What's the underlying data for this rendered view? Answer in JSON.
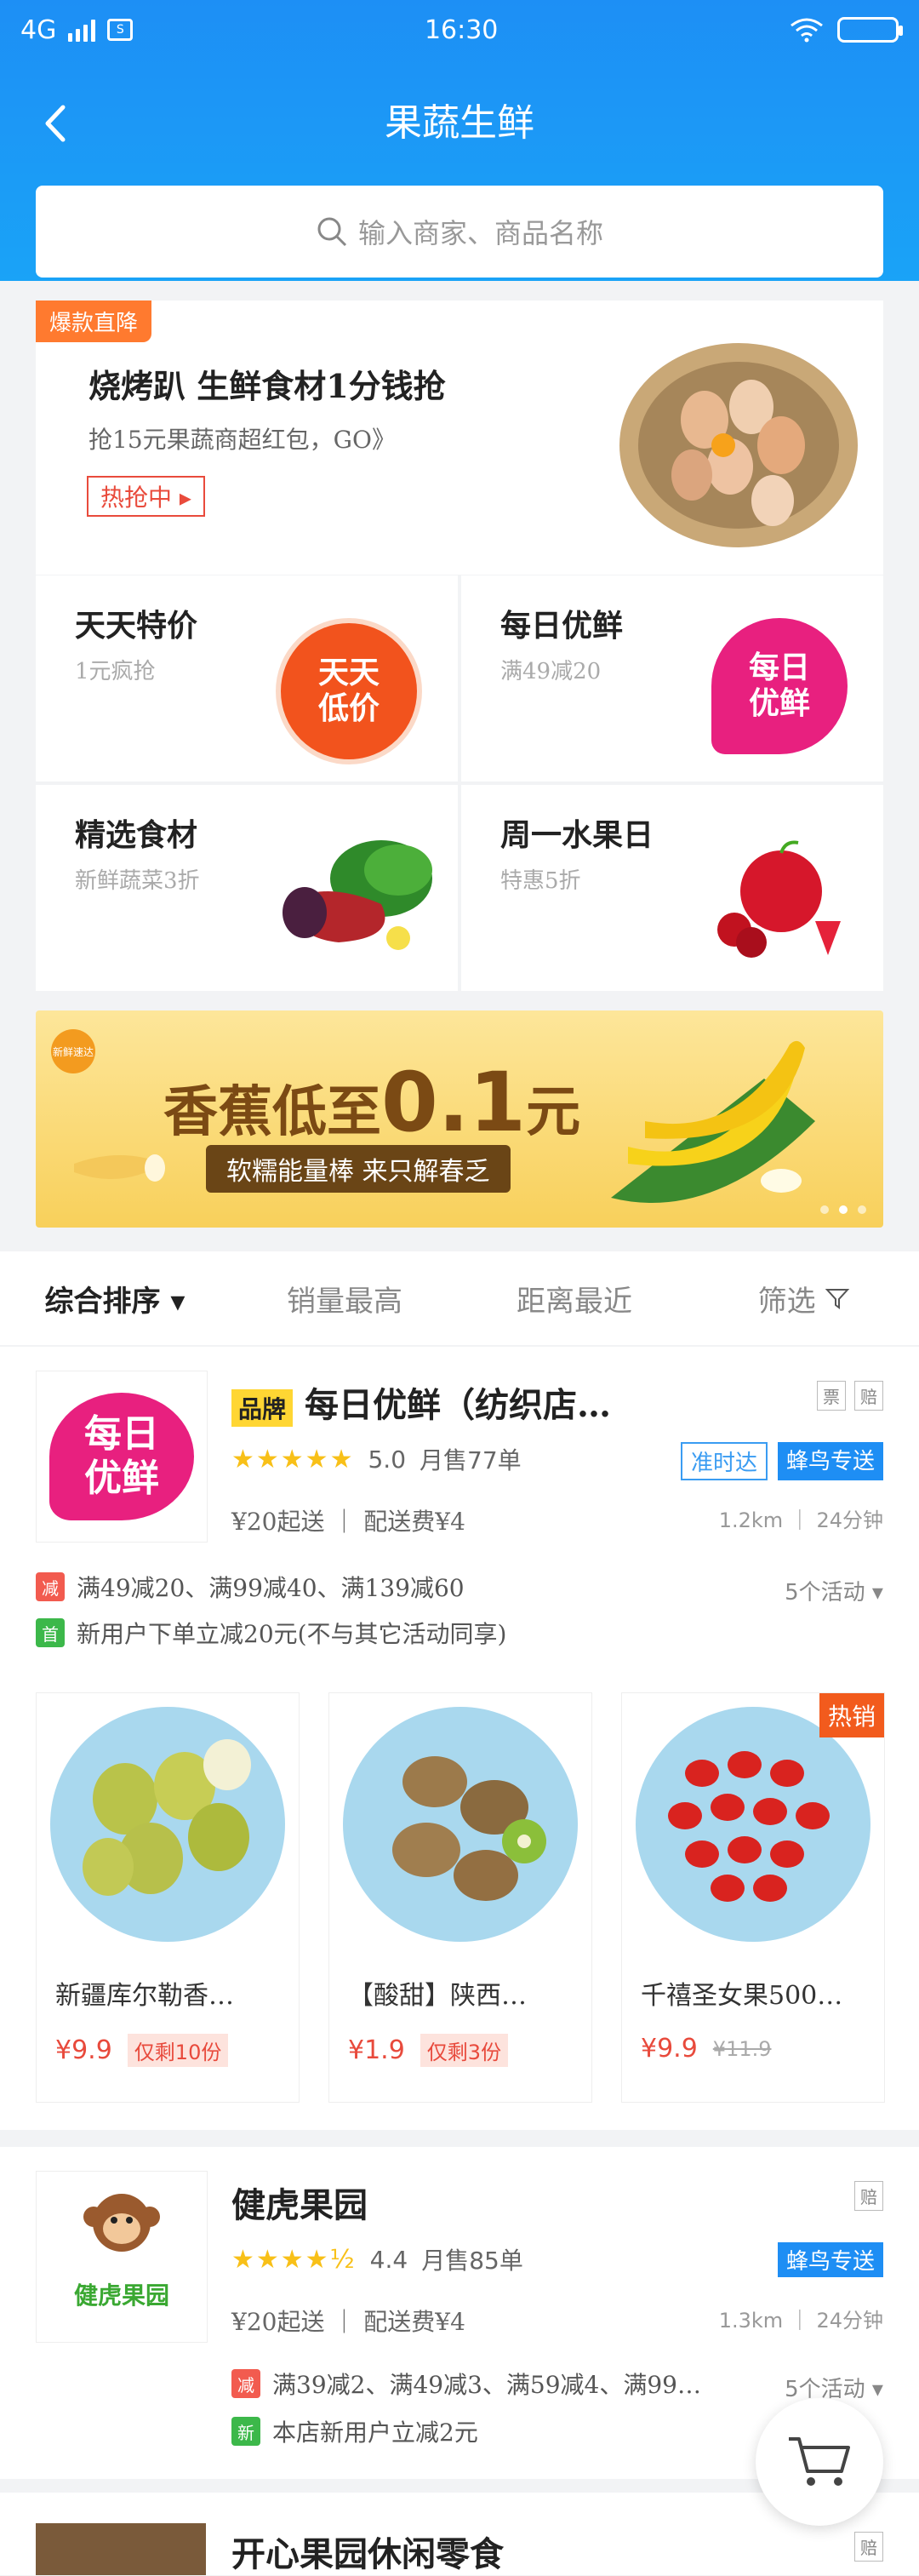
{
  "status_bar": {
    "network": "4G",
    "time": "16:30"
  },
  "header": {
    "title": "果蔬生鲜",
    "back_icon": "back-arrow-icon"
  },
  "search": {
    "placeholder": "输入商家、商品名称"
  },
  "promo": {
    "tag": "爆款直降",
    "title": "烧烤趴 生鲜食材1分钱抢",
    "subtitle": "抢15元果蔬商超红包，GO》",
    "button": "热抢中"
  },
  "categories": [
    {
      "title": "天天特价",
      "desc": "1元疯抢",
      "badge": "天天\n低价",
      "color": "#f2531d"
    },
    {
      "title": "每日优鲜",
      "desc": "满49减20",
      "badge": "每日\n优鲜",
      "color": "#e8207f"
    },
    {
      "title": "精选食材",
      "desc": "新鲜蔬菜3折"
    },
    {
      "title": "周一水果日",
      "desc": "特惠5折"
    }
  ],
  "banner": {
    "headline": "香蕉低至",
    "amount": "0.1",
    "unit": "元",
    "pill": "软糯能量棒 来只解春乏",
    "logo_text": "新鲜速达"
  },
  "sort": {
    "items": [
      "综合排序",
      "销量最高",
      "距离最近",
      "筛选"
    ]
  },
  "stores": [
    {
      "brand": "品牌",
      "name": "每日优鲜（纺织店…",
      "logo_text": "每日\n优鲜",
      "tags": [
        "票",
        "赔"
      ],
      "stars": "★★★★★",
      "score": "5.0",
      "monthly": "月售77单",
      "delivery_tags": [
        "准时达",
        "蜂鸟专送"
      ],
      "min_order": "¥20起送",
      "fee": "配送费¥4",
      "distance": "1.2km",
      "time": "24分钟",
      "promos": [
        {
          "icon": "减",
          "text": "满49减20、满99减40、满139减60"
        },
        {
          "icon": "首",
          "text": "新用户下单立减20元(不与其它活动同享)"
        }
      ],
      "activity_count": "5个活动",
      "products": [
        {
          "name": "新疆库尔勒香…",
          "price": "¥9.9",
          "limit": "仅剩10份"
        },
        {
          "name": "【酸甜】陕西…",
          "price": "¥1.9",
          "limit": "仅剩3份"
        },
        {
          "name": "千禧圣女果500…",
          "price": "¥9.9",
          "old": "¥11.9",
          "hot": "热销"
        }
      ]
    },
    {
      "name": "健虎果园",
      "logo_text": "健虎果园",
      "tags": [
        "赔"
      ],
      "stars": "★★★★½",
      "score": "4.4",
      "monthly": "月售85单",
      "delivery_tags": [
        "蜂鸟专送"
      ],
      "min_order": "¥20起送",
      "fee": "配送费¥4",
      "distance": "1.3km",
      "time": "24分钟",
      "promos": [
        {
          "icon": "减",
          "text": "满39减2、满49减3、满59减4、满99…"
        },
        {
          "icon": "新",
          "text": "本店新用户立减2元"
        }
      ],
      "activity_count": "5个活动"
    },
    {
      "name": "开心果园休闲零食",
      "tags": [
        "赔"
      ]
    }
  ],
  "colors": {
    "primary": "#1d8ff5",
    "accent": "#e84a3c"
  }
}
